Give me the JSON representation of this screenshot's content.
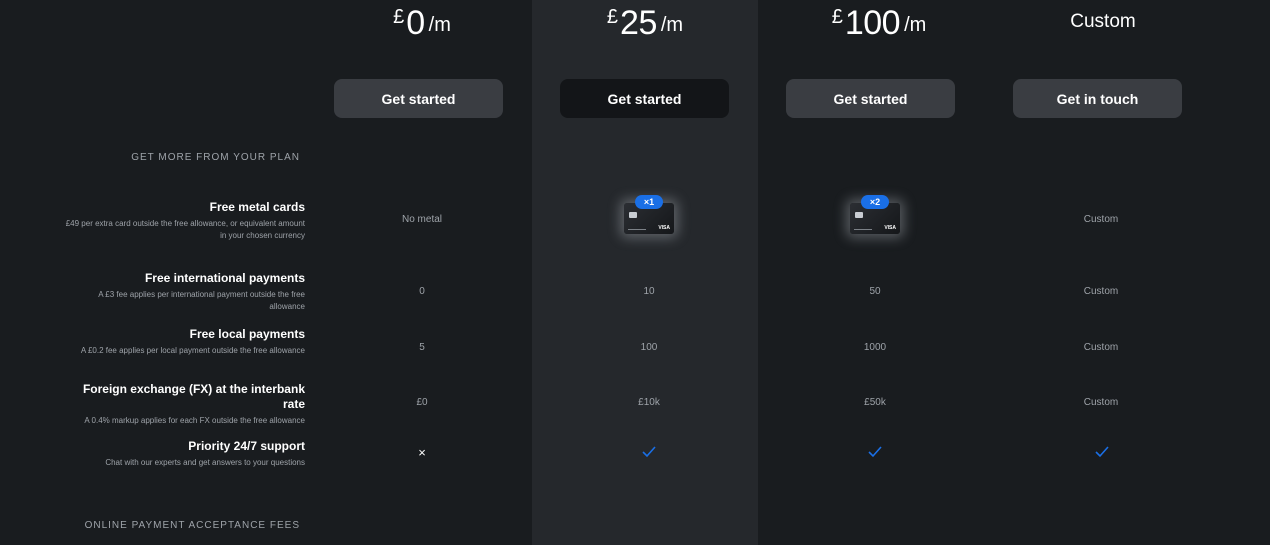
{
  "plans": [
    {
      "currency": "£",
      "amount": "0",
      "period": "/m",
      "button": "Get started"
    },
    {
      "currency": "£",
      "amount": "25",
      "period": "/m",
      "button": "Get started"
    },
    {
      "currency": "£",
      "amount": "100",
      "period": "/m",
      "button": "Get started"
    },
    {
      "custom_label": "Custom",
      "button": "Get in touch"
    }
  ],
  "sections": {
    "more": "GET MORE FROM YOUR PLAN",
    "online": "ONLINE PAYMENT ACCEPTANCE FEES"
  },
  "features": [
    {
      "name": "Free metal cards",
      "desc": "£49 per extra card outside the free allowance, or equivalent amount in your chosen currency",
      "values": [
        "No metal",
        {
          "badge": "×1",
          "icon": "metal-card-icon"
        },
        {
          "badge": "×2",
          "icon": "metal-card-icon"
        },
        "Custom"
      ]
    },
    {
      "name": "Free international payments",
      "desc": "A £3 fee applies per international payment outside the free allowance",
      "values": [
        "0",
        "10",
        "50",
        "Custom"
      ]
    },
    {
      "name": "Free local payments",
      "desc": "A £0.2 fee applies per local payment outside the free allowance",
      "values": [
        "5",
        "100",
        "1000",
        "Custom"
      ]
    },
    {
      "name": "Foreign exchange (FX) at the interbank rate",
      "desc": "A 0.4% markup applies for each FX outside the free allowance",
      "values": [
        "£0",
        "£10k",
        "£50k",
        "Custom"
      ]
    },
    {
      "name": "Priority 24/7 support",
      "desc": "Chat with our experts and get answers to your questions",
      "values": [
        "×",
        "check-icon",
        "check-icon",
        "check-icon"
      ]
    }
  ],
  "card_text": "VISA",
  "colors": {
    "background": "#191c1f",
    "highlight_column": "#25282c",
    "check": "#1a6fe6"
  }
}
